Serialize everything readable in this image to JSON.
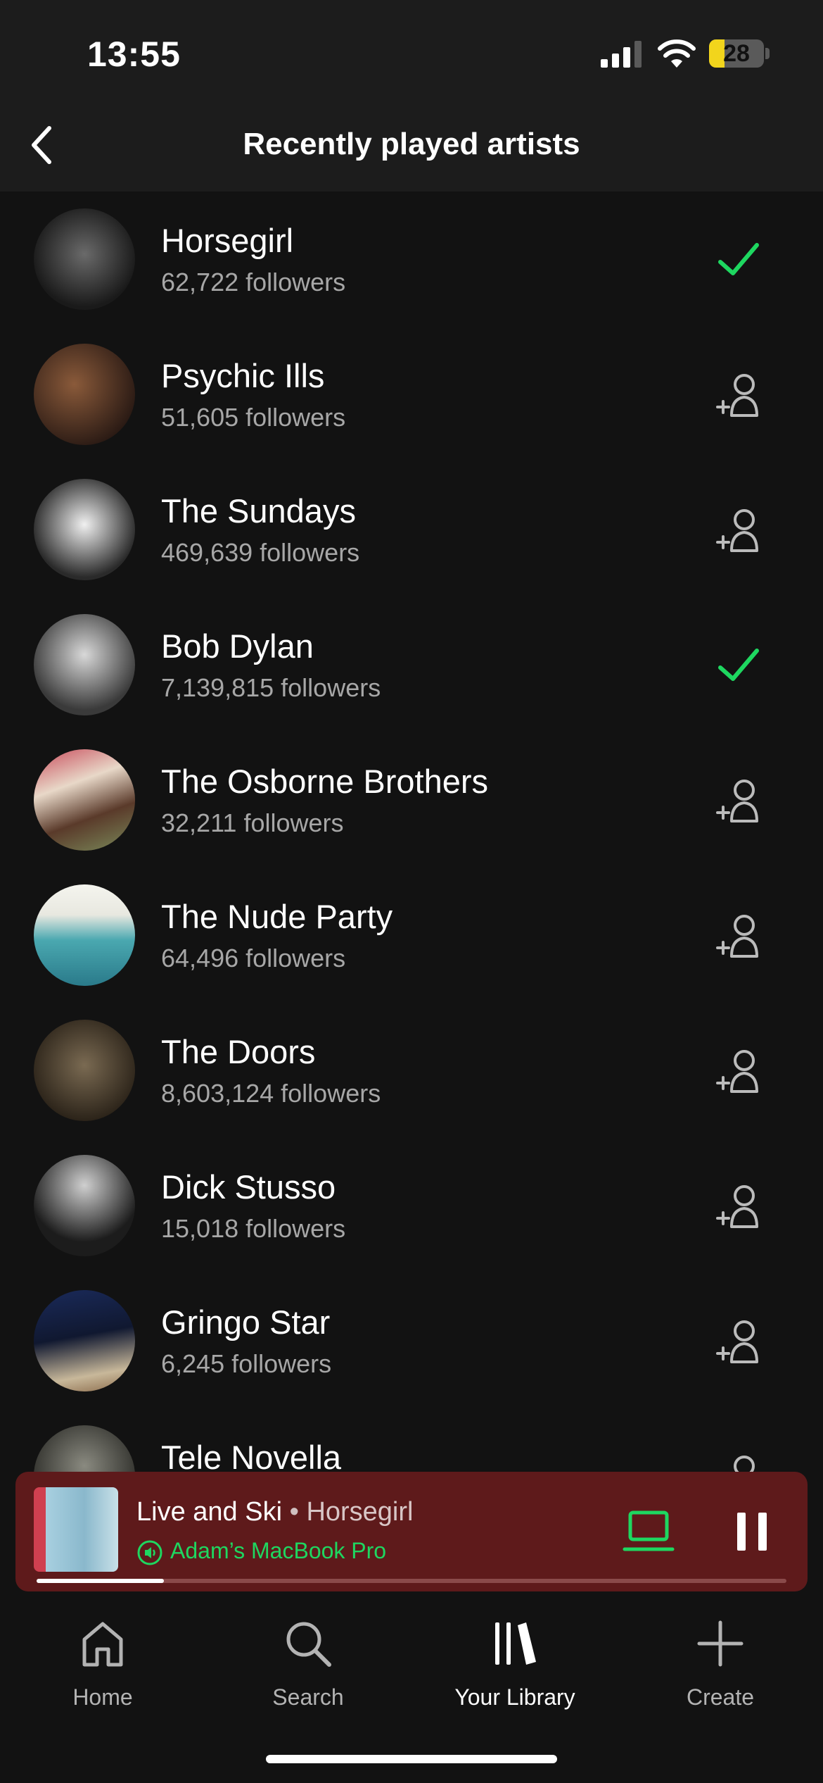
{
  "status_bar": {
    "time": "13:55",
    "battery": "28",
    "battery_level": 0.28
  },
  "header": {
    "title": "Recently played artists"
  },
  "artists": [
    {
      "name": "Horsegirl",
      "followers": "62,722 followers",
      "following": true
    },
    {
      "name": "Psychic Ills",
      "followers": "51,605 followers",
      "following": false
    },
    {
      "name": "The Sundays",
      "followers": "469,639 followers",
      "following": false
    },
    {
      "name": "Bob Dylan",
      "followers": "7,139,815 followers",
      "following": true
    },
    {
      "name": "The Osborne Brothers",
      "followers": "32,211 followers",
      "following": false
    },
    {
      "name": "The Nude Party",
      "followers": "64,496 followers",
      "following": false
    },
    {
      "name": "The Doors",
      "followers": "8,603,124 followers",
      "following": false
    },
    {
      "name": "Dick Stusso",
      "followers": "15,018 followers",
      "following": false
    },
    {
      "name": "Gringo Star",
      "followers": "6,245 followers",
      "following": false
    },
    {
      "name": "Tele Novella",
      "followers": "",
      "following": false
    }
  ],
  "now_playing": {
    "title": "Live and Ski",
    "separator": " • ",
    "artist": "Horsegirl",
    "device": "Adam’s MacBook Pro",
    "progress": 0.17
  },
  "nav": {
    "home": "Home",
    "search": "Search",
    "library": "Your Library",
    "create": "Create"
  },
  "colors": {
    "accent": "#1ed760",
    "player_bg": "#5e1a1b",
    "background": "#121212"
  },
  "icons": {
    "back": "chevron-left-icon",
    "following": "check-icon",
    "follow": "add-user-icon",
    "connect": "laptop-icon",
    "pause": "pause-icon",
    "speaker": "speaker-icon"
  }
}
